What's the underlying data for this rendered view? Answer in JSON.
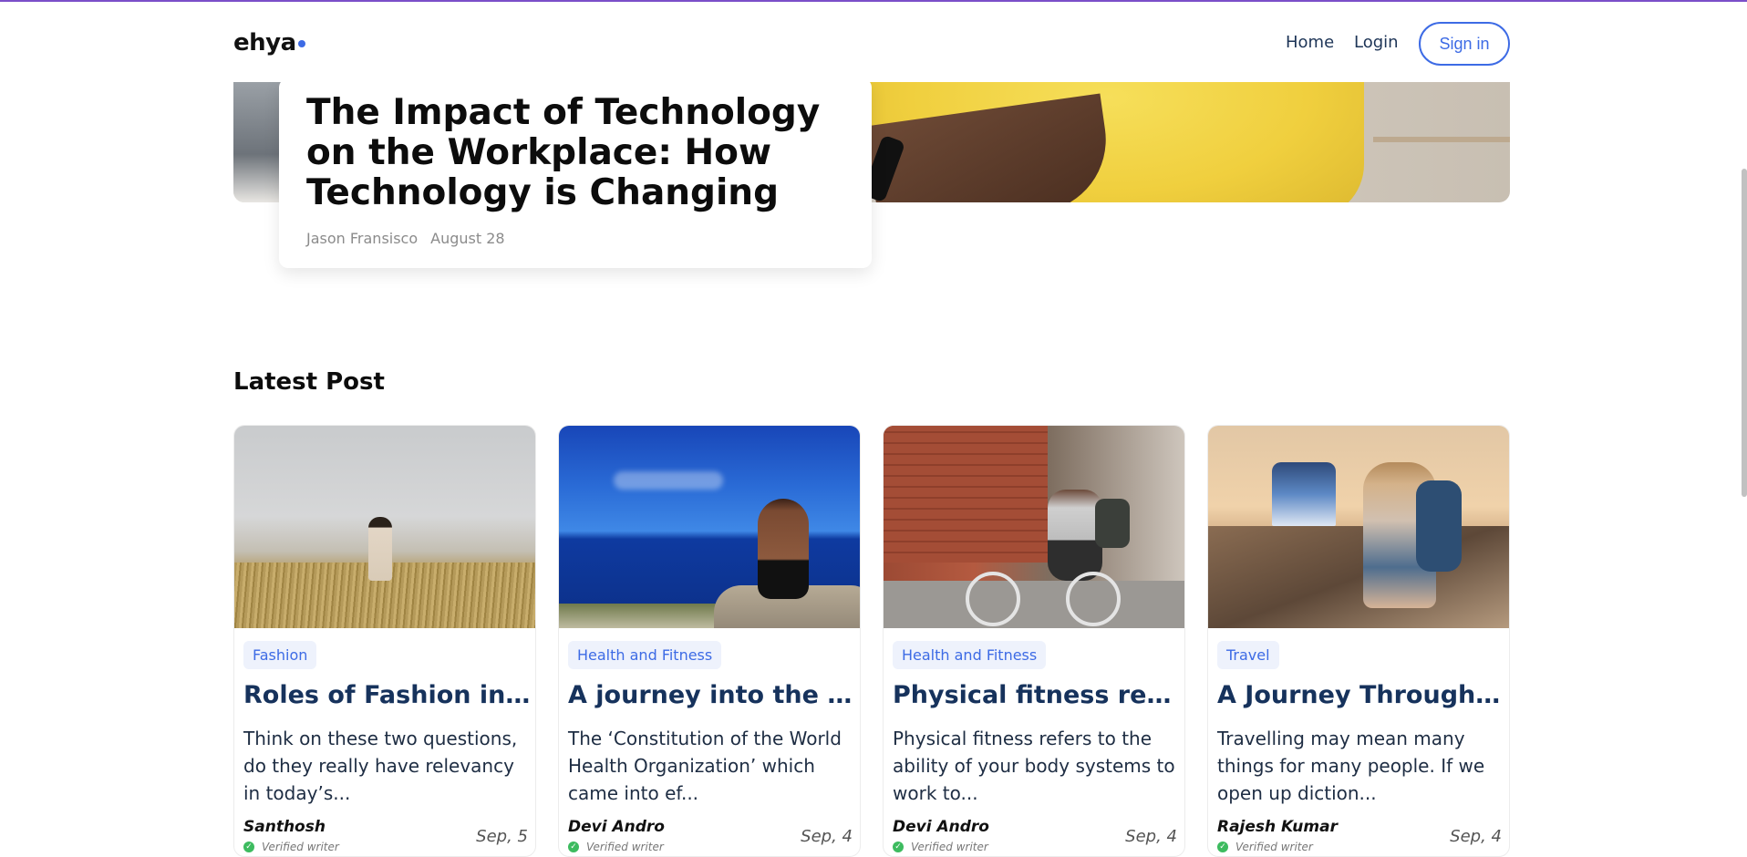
{
  "brand": {
    "logo_text": "ehya",
    "accent": "#3d6be5"
  },
  "nav": {
    "home": "Home",
    "login": "Login",
    "signin": "Sign in"
  },
  "hero": {
    "title": "The Impact of Technology on the Workplace: How Technology is Changing",
    "author": "Jason Fransisco",
    "date": "August 28"
  },
  "latest": {
    "heading": "Latest Post",
    "posts": [
      {
        "tag": "Fashion",
        "title": "Roles of Fashion in Ou...",
        "excerpt": "Think on these two questions, do they really have relevancy in today’s...",
        "author": "Santhosh",
        "verified": "Verified writer",
        "date": "Sep, 5"
      },
      {
        "tag": "Health and Fitness",
        "title": "A journey into the wo...",
        "excerpt": "The ‘Constitution of the World Health Organization’ which came into ef...",
        "author": "Devi Andro",
        "verified": "Verified writer",
        "date": "Sep, 4"
      },
      {
        "tag": "Health and Fitness",
        "title": "Physical fitness refers...",
        "excerpt": "Physical fitness refers to the ability of your body systems to work to...",
        "author": "Devi Andro",
        "verified": "Verified writer",
        "date": "Sep, 4"
      },
      {
        "tag": "Travel",
        "title": "A Journey Through Life.",
        "excerpt": "Travelling may mean many things for many people. If we open up diction...",
        "author": "Rajesh Kumar",
        "verified": "Verified writer",
        "date": "Sep, 4"
      }
    ]
  }
}
